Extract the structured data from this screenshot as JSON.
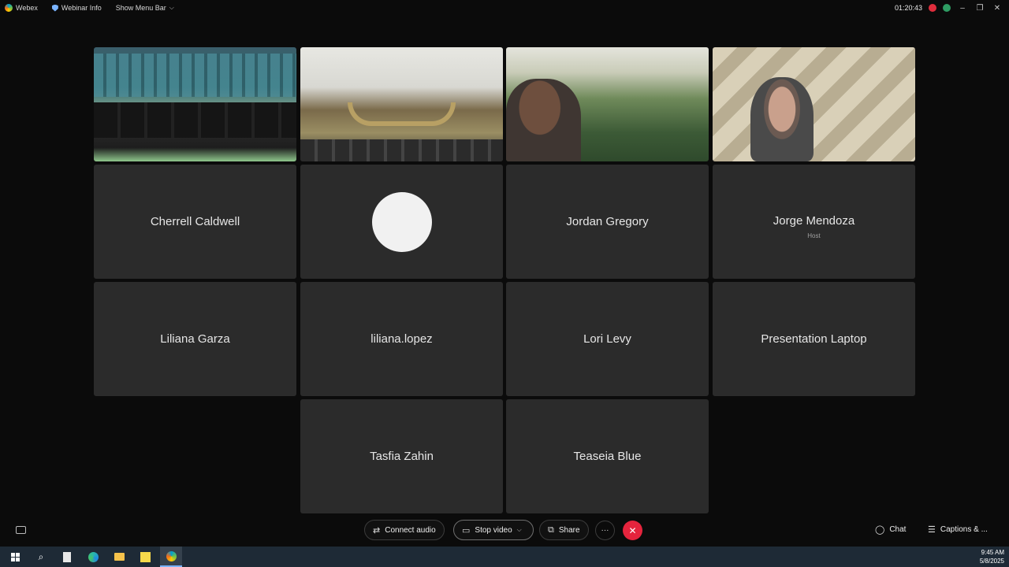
{
  "topbar": {
    "app_name": "Webex",
    "webinar_info": "Webinar Info",
    "show_menu_bar": "Show Menu Bar",
    "timer": "01:20:43"
  },
  "tiles": [
    {
      "name": "",
      "type": "video-council-chamber-seats"
    },
    {
      "name": "",
      "type": "video-council-chamber-dais"
    },
    {
      "name": "",
      "type": "video-participant-aerial"
    },
    {
      "name": "",
      "type": "video-participant-host"
    },
    {
      "name": "Cherrell Caldwell",
      "type": "name"
    },
    {
      "name": "",
      "type": "avatar"
    },
    {
      "name": "Jordan Gregory",
      "type": "name"
    },
    {
      "name": "Jorge Mendoza",
      "role": "Host",
      "type": "name"
    },
    {
      "name": "Liliana Garza",
      "type": "name"
    },
    {
      "name": "liliana.lopez",
      "type": "name"
    },
    {
      "name": "Lori Levy",
      "type": "name"
    },
    {
      "name": "Presentation Laptop",
      "type": "name"
    },
    {
      "name": "Tasfia Zahin",
      "type": "name"
    },
    {
      "name": "Teaseia Blue",
      "type": "name"
    }
  ],
  "toolbar": {
    "connect_audio": "Connect audio",
    "stop_video": "Stop video",
    "share": "Share",
    "more": "···",
    "end": "✕",
    "chat": "Chat",
    "captions": "Captions & ..."
  },
  "taskbar": {
    "time": "9:45 AM",
    "date": "5/8/2025"
  },
  "colors": {
    "end_button": "#e5243d",
    "tile_bg": "#2b2b2b",
    "background": "#0b0b0b"
  }
}
